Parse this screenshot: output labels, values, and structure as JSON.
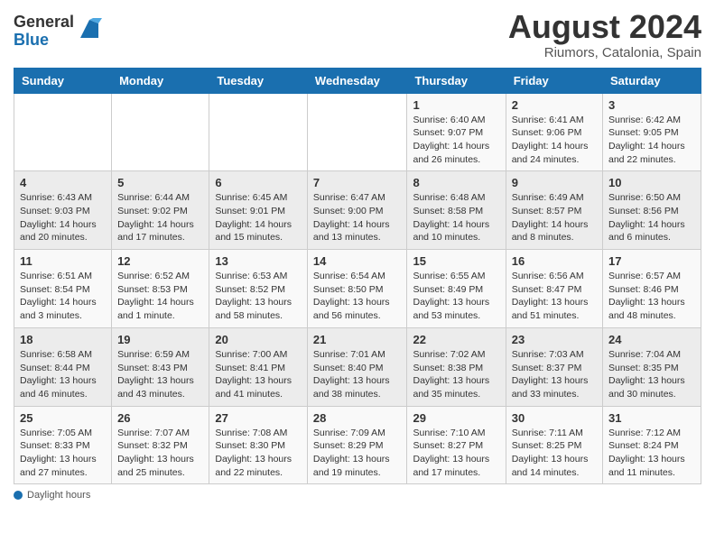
{
  "header": {
    "logo_general": "General",
    "logo_blue": "Blue",
    "month_year": "August 2024",
    "location": "Riumors, Catalonia, Spain"
  },
  "days_of_week": [
    "Sunday",
    "Monday",
    "Tuesday",
    "Wednesday",
    "Thursday",
    "Friday",
    "Saturday"
  ],
  "weeks": [
    [
      {
        "day": "",
        "info": ""
      },
      {
        "day": "",
        "info": ""
      },
      {
        "day": "",
        "info": ""
      },
      {
        "day": "",
        "info": ""
      },
      {
        "day": "1",
        "info": "Sunrise: 6:40 AM\nSunset: 9:07 PM\nDaylight: 14 hours and 26 minutes."
      },
      {
        "day": "2",
        "info": "Sunrise: 6:41 AM\nSunset: 9:06 PM\nDaylight: 14 hours and 24 minutes."
      },
      {
        "day": "3",
        "info": "Sunrise: 6:42 AM\nSunset: 9:05 PM\nDaylight: 14 hours and 22 minutes."
      }
    ],
    [
      {
        "day": "4",
        "info": "Sunrise: 6:43 AM\nSunset: 9:03 PM\nDaylight: 14 hours and 20 minutes."
      },
      {
        "day": "5",
        "info": "Sunrise: 6:44 AM\nSunset: 9:02 PM\nDaylight: 14 hours and 17 minutes."
      },
      {
        "day": "6",
        "info": "Sunrise: 6:45 AM\nSunset: 9:01 PM\nDaylight: 14 hours and 15 minutes."
      },
      {
        "day": "7",
        "info": "Sunrise: 6:47 AM\nSunset: 9:00 PM\nDaylight: 14 hours and 13 minutes."
      },
      {
        "day": "8",
        "info": "Sunrise: 6:48 AM\nSunset: 8:58 PM\nDaylight: 14 hours and 10 minutes."
      },
      {
        "day": "9",
        "info": "Sunrise: 6:49 AM\nSunset: 8:57 PM\nDaylight: 14 hours and 8 minutes."
      },
      {
        "day": "10",
        "info": "Sunrise: 6:50 AM\nSunset: 8:56 PM\nDaylight: 14 hours and 6 minutes."
      }
    ],
    [
      {
        "day": "11",
        "info": "Sunrise: 6:51 AM\nSunset: 8:54 PM\nDaylight: 14 hours and 3 minutes."
      },
      {
        "day": "12",
        "info": "Sunrise: 6:52 AM\nSunset: 8:53 PM\nDaylight: 14 hours and 1 minute."
      },
      {
        "day": "13",
        "info": "Sunrise: 6:53 AM\nSunset: 8:52 PM\nDaylight: 13 hours and 58 minutes."
      },
      {
        "day": "14",
        "info": "Sunrise: 6:54 AM\nSunset: 8:50 PM\nDaylight: 13 hours and 56 minutes."
      },
      {
        "day": "15",
        "info": "Sunrise: 6:55 AM\nSunset: 8:49 PM\nDaylight: 13 hours and 53 minutes."
      },
      {
        "day": "16",
        "info": "Sunrise: 6:56 AM\nSunset: 8:47 PM\nDaylight: 13 hours and 51 minutes."
      },
      {
        "day": "17",
        "info": "Sunrise: 6:57 AM\nSunset: 8:46 PM\nDaylight: 13 hours and 48 minutes."
      }
    ],
    [
      {
        "day": "18",
        "info": "Sunrise: 6:58 AM\nSunset: 8:44 PM\nDaylight: 13 hours and 46 minutes."
      },
      {
        "day": "19",
        "info": "Sunrise: 6:59 AM\nSunset: 8:43 PM\nDaylight: 13 hours and 43 minutes."
      },
      {
        "day": "20",
        "info": "Sunrise: 7:00 AM\nSunset: 8:41 PM\nDaylight: 13 hours and 41 minutes."
      },
      {
        "day": "21",
        "info": "Sunrise: 7:01 AM\nSunset: 8:40 PM\nDaylight: 13 hours and 38 minutes."
      },
      {
        "day": "22",
        "info": "Sunrise: 7:02 AM\nSunset: 8:38 PM\nDaylight: 13 hours and 35 minutes."
      },
      {
        "day": "23",
        "info": "Sunrise: 7:03 AM\nSunset: 8:37 PM\nDaylight: 13 hours and 33 minutes."
      },
      {
        "day": "24",
        "info": "Sunrise: 7:04 AM\nSunset: 8:35 PM\nDaylight: 13 hours and 30 minutes."
      }
    ],
    [
      {
        "day": "25",
        "info": "Sunrise: 7:05 AM\nSunset: 8:33 PM\nDaylight: 13 hours and 27 minutes."
      },
      {
        "day": "26",
        "info": "Sunrise: 7:07 AM\nSunset: 8:32 PM\nDaylight: 13 hours and 25 minutes."
      },
      {
        "day": "27",
        "info": "Sunrise: 7:08 AM\nSunset: 8:30 PM\nDaylight: 13 hours and 22 minutes."
      },
      {
        "day": "28",
        "info": "Sunrise: 7:09 AM\nSunset: 8:29 PM\nDaylight: 13 hours and 19 minutes."
      },
      {
        "day": "29",
        "info": "Sunrise: 7:10 AM\nSunset: 8:27 PM\nDaylight: 13 hours and 17 minutes."
      },
      {
        "day": "30",
        "info": "Sunrise: 7:11 AM\nSunset: 8:25 PM\nDaylight: 13 hours and 14 minutes."
      },
      {
        "day": "31",
        "info": "Sunrise: 7:12 AM\nSunset: 8:24 PM\nDaylight: 13 hours and 11 minutes."
      }
    ]
  ],
  "footer": {
    "label": "Daylight hours"
  }
}
